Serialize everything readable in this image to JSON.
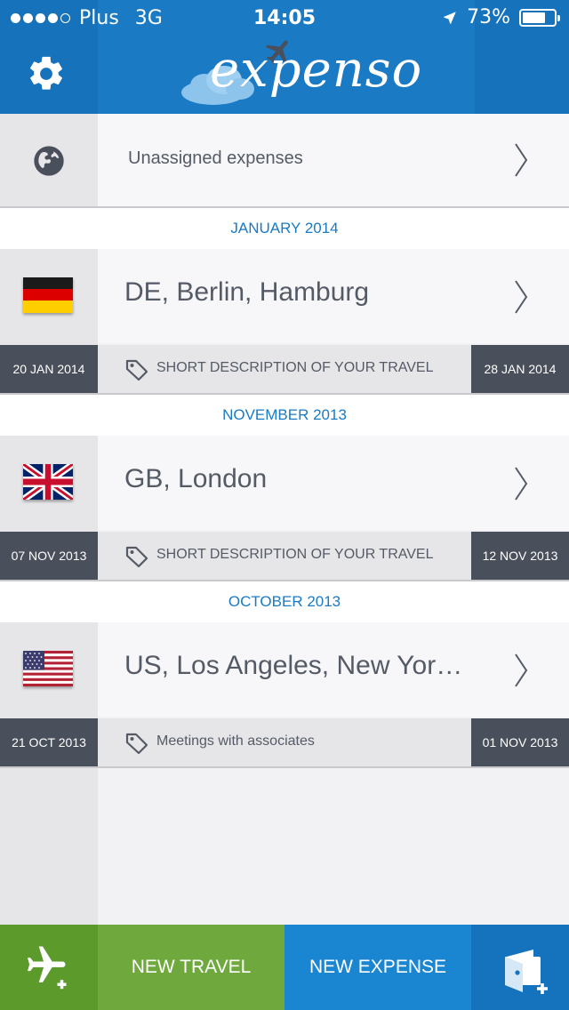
{
  "status_bar": {
    "carrier": "Plus",
    "network": "3G",
    "time": "14:05",
    "battery": "73%",
    "battery_level": 0.73,
    "signal_dots_filled": 4,
    "signal_dots_total": 5
  },
  "header": {
    "logo_text": "expenso",
    "settings_icon": "gear-icon"
  },
  "unassigned": {
    "label": "Unassigned expenses",
    "icon": "globe-icon"
  },
  "groups": [
    {
      "month": "JANUARY 2014",
      "travel": {
        "title": "DE, Berlin, Hamburg",
        "flag": "germany-flag",
        "start_date": "20 JAN 2014",
        "end_date": "28 JAN 2014",
        "description": "SHORT DESCRIPTION OF YOUR TRAVEL"
      }
    },
    {
      "month": "NOVEMBER 2013",
      "travel": {
        "title": "GB, London",
        "flag": "uk-flag",
        "start_date": "07 NOV 2013",
        "end_date": "12 NOV 2013",
        "description": "SHORT DESCRIPTION OF YOUR TRAVEL"
      }
    },
    {
      "month": "OCTOBER 2013",
      "travel": {
        "title": "US, Los Angeles, New York,…",
        "flag": "usa-flag",
        "start_date": "21 OCT 2013",
        "end_date": "01 NOV 2013",
        "description": "Meetings with associates"
      }
    }
  ],
  "bottom_bar": {
    "new_travel": "NEW TRAVEL",
    "new_expense": "NEW EXPENSE",
    "add_travel_icon": "add-plane-icon",
    "add_expense_icon": "add-wallet-icon"
  },
  "colors": {
    "header_blue": "#1a7ac3",
    "month_blue": "#1a7ac3",
    "date_dark": "#4a4f5c",
    "travel_green": "#6fa83d",
    "expense_blue": "#1a85d0"
  }
}
